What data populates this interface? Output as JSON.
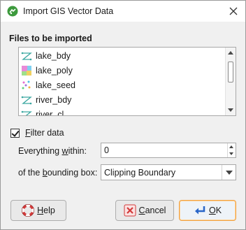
{
  "window": {
    "title": "Import GIS Vector Data",
    "icons": {
      "app": "leapfrog-app-icon",
      "close": "close-icon"
    }
  },
  "files_section": {
    "label": "Files to be imported",
    "items": [
      {
        "label": "lake_bdy",
        "icon": "polyline-icon"
      },
      {
        "label": "lake_poly",
        "icon": "polygon-icon"
      },
      {
        "label": "lake_seed",
        "icon": "points-icon"
      },
      {
        "label": "river_bdy",
        "icon": "polyline-icon"
      },
      {
        "label": "river_cl",
        "icon": "polyline-icon"
      }
    ]
  },
  "filter": {
    "checked": true,
    "label_pre": "",
    "label_ul": "F",
    "label_post": "ilter data"
  },
  "within": {
    "label_pre": "Everything ",
    "label_ul": "w",
    "label_post": "ithin:",
    "value": "0"
  },
  "bounding": {
    "label_pre": "of the ",
    "label_ul": "b",
    "label_post": "ounding box:",
    "value": "Clipping Boundary"
  },
  "buttons": {
    "help": {
      "ul": "H",
      "rest": "elp",
      "icon": "lifebuoy-icon"
    },
    "cancel": {
      "ul": "C",
      "rest": "ancel",
      "icon": "cancel-icon"
    },
    "ok": {
      "ul": "O",
      "rest": "K",
      "icon": "enter-arrow-icon"
    }
  },
  "colors": {
    "ok_border": "#f0a040",
    "polyline_icon": "#3aa7a0",
    "cancel_icon": "#d23a3a",
    "help_icon": "#d23a3a",
    "ok_icon": "#2a66c8"
  }
}
